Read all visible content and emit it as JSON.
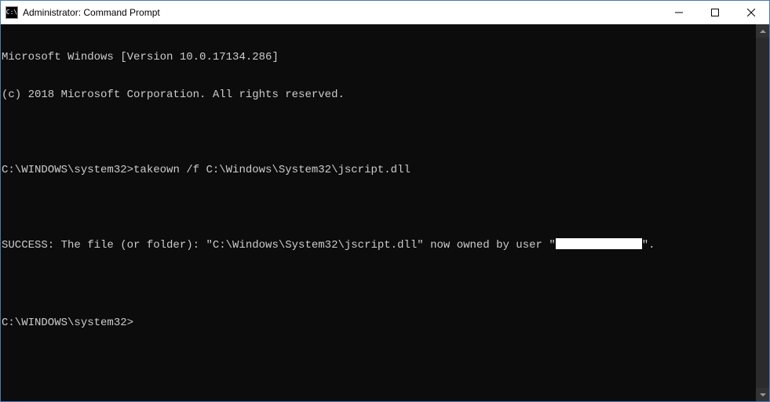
{
  "window": {
    "title": "Administrator: Command Prompt",
    "icon_glyph": "C:\\"
  },
  "terminal": {
    "header_line1": "Microsoft Windows [Version 10.0.17134.286]",
    "header_line2": "(c) 2018 Microsoft Corporation. All rights reserved.",
    "prompt1_path": "C:\\WINDOWS\\system32>",
    "prompt1_command": "takeown /f C:\\Windows\\System32\\jscript.dll",
    "success_prefix": "SUCCESS: The file (or folder): \"C:\\Windows\\System32\\jscript.dll\" now owned by user \"",
    "success_suffix": "\".",
    "prompt2_path": "C:\\WINDOWS\\system32>"
  }
}
